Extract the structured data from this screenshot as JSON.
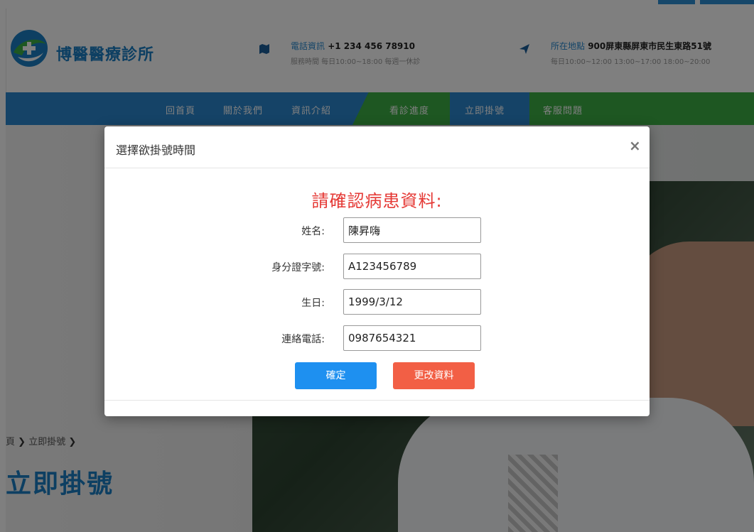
{
  "header": {
    "brand": "博醫醫療診所",
    "phone": {
      "key": "電話資訊",
      "value": " +1 234 456 78910",
      "hours": "服務時間 每日10:00~18:00 每週一休診"
    },
    "address": {
      "key": "所在地點",
      "value": " 900屏東縣屏東市民生東路51號",
      "hours": "每日10:00~12:00 13:00~17:00 18:00~20:00"
    }
  },
  "nav": {
    "items": [
      "回首頁",
      "關於我們",
      "資訊介紹",
      "看診進度",
      "立即掛號",
      "客服問題"
    ]
  },
  "breadcrumb": {
    "home": "頁",
    "sep": "❯",
    "current": "立即掛號"
  },
  "page_title": "立即掛號",
  "modal": {
    "title": "選擇欲掛號時間",
    "close": "×",
    "heading": "請確認病患資料:",
    "fields": [
      {
        "label": "姓名:",
        "value": "陳昇嗨"
      },
      {
        "label": "身分證字號:",
        "value": "A123456789"
      },
      {
        "label": "生日:",
        "value": "1999/3/12"
      },
      {
        "label": "連絡電話:",
        "value": "0987654321"
      }
    ],
    "confirm_label": "確定",
    "edit_label": "更改資料"
  },
  "colors": {
    "primary_blue": "#2b87cf",
    "nav_green": "#3cae45",
    "heading_red": "#e53935",
    "confirm_button": "#1e90f0",
    "edit_button": "#f25f45"
  }
}
